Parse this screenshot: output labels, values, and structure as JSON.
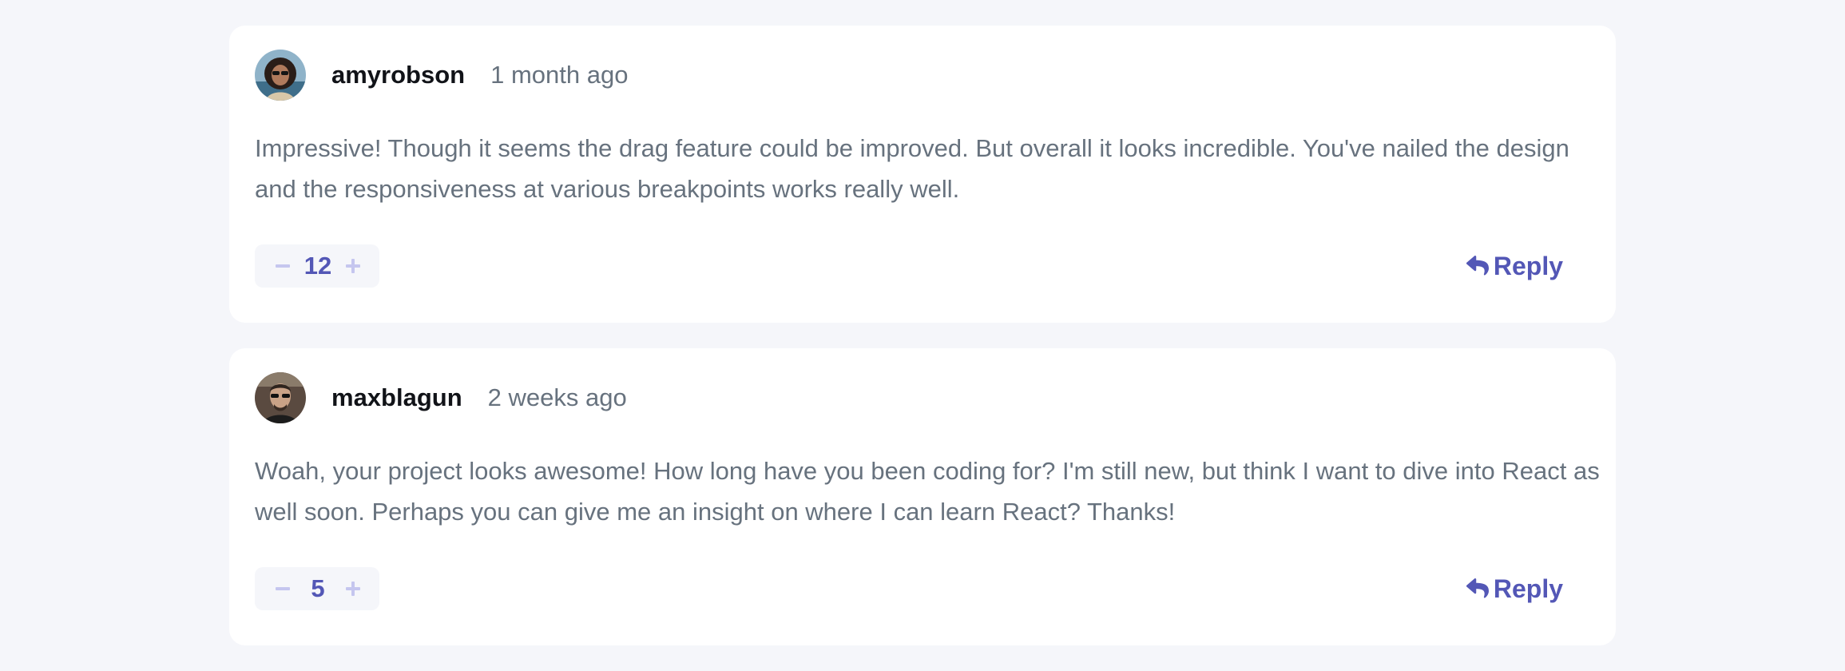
{
  "comments": [
    {
      "username": "amyrobson",
      "created_at": "1 month ago",
      "content": "Impressive! Though it seems the drag feature could be improved. But overall it looks incredible. You've nailed the design and the responsiveness at various breakpoints works really well.",
      "score": "12",
      "reply_label": "Reply"
    },
    {
      "username": "maxblagun",
      "created_at": "2 weeks ago",
      "content": "Woah, your project looks awesome! How long have you been coding for? I'm still new, but think I want to dive into React as well soon. Perhaps you can give me an insight on where I can learn React? Thanks!",
      "score": "5",
      "reply_label": "Reply"
    }
  ],
  "icons": {
    "minus": "minus-icon",
    "plus": "plus-icon",
    "reply": "reply-icon"
  },
  "colors": {
    "background": "#f5f6fa",
    "card": "#ffffff",
    "accent": "#5357b6",
    "accent_light": "#c5c6ef",
    "text": "#67727e",
    "username": "#111318"
  }
}
